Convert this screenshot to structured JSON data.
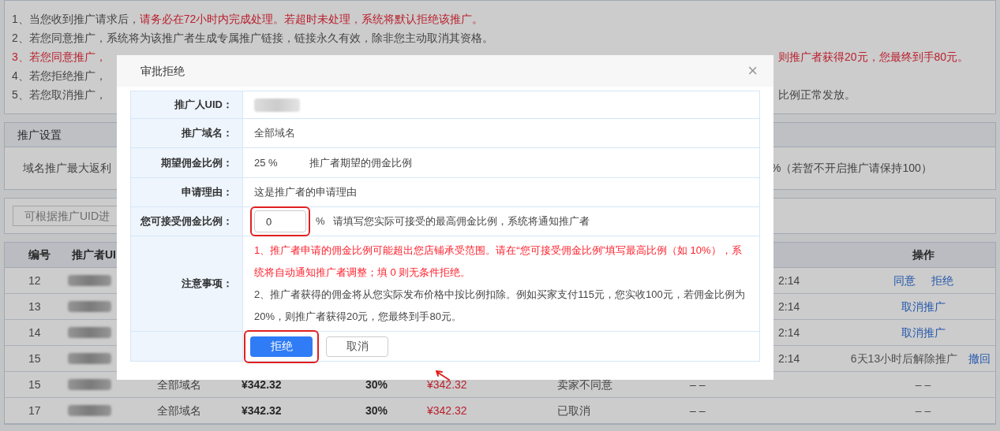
{
  "notices": [
    {
      "left": [
        {
          "text": "1、当您收到推广请求后，",
          "alert": false
        },
        {
          "text": "请务必在72小时内完成处理。若超时未处理，系统将默认拒绝该推广。",
          "alert": true
        }
      ]
    },
    {
      "left": [
        {
          "text": "2、若您同意推广，系统将为该推广者生成专属推广链接，链接永久有效，除非您主动取消其资格。",
          "alert": false
        }
      ]
    },
    {
      "left": [
        {
          "text": "3、若您同意推广，",
          "alert": true
        }
      ],
      "right": {
        "text": "则推广者获得20元，您最终到手80元。",
        "alert": true
      }
    },
    {
      "left": [
        {
          "text": "4、若您拒绝推广，",
          "alert": false
        }
      ]
    },
    {
      "left": [
        {
          "text": "5、若您取消推广，",
          "alert": false
        }
      ],
      "right": {
        "text": "比例正常发放。",
        "alert": false
      }
    }
  ],
  "settings": {
    "title": "推广设置",
    "label": "域名推广最大返利",
    "hint": "%（若暂不开启推广请保持100）"
  },
  "search": {
    "placeholder": "可根据推广UID进"
  },
  "table": {
    "columns": [
      "编号",
      "推广者UI"
    ],
    "action_column": "操作",
    "rows": [
      {
        "id": "12",
        "time": "2:14",
        "actions": [
          {
            "text": "同意",
            "kind": "link"
          },
          {
            "text": "拒绝",
            "kind": "link"
          }
        ]
      },
      {
        "id": "13",
        "time": "2:14",
        "actions": [
          {
            "text": "取消推广",
            "kind": "link"
          }
        ]
      },
      {
        "id": "14",
        "time": "2:14",
        "actions": [
          {
            "text": "取消推广",
            "kind": "link"
          }
        ]
      },
      {
        "id": "15",
        "time": "2:14",
        "actions": [
          {
            "text": "6天13小时后解除推广",
            "kind": "text"
          },
          {
            "text": "撤回",
            "kind": "link"
          }
        ]
      },
      {
        "id": "15",
        "domain": "全部域名",
        "price": "¥342.32",
        "ratio": "30%",
        "income": "¥342.32",
        "status": "卖家不同意",
        "time": "– –",
        "actions": [
          {
            "text": "– –",
            "kind": "text"
          }
        ]
      },
      {
        "id": "17",
        "domain": "全部域名",
        "price": "¥342.32",
        "ratio": "30%",
        "income": "¥342.32",
        "status": "已取消",
        "time": "– –",
        "actions": [
          {
            "text": "– –",
            "kind": "text"
          }
        ]
      }
    ]
  },
  "dialog": {
    "title": "审批拒绝",
    "close": "×",
    "fields": [
      {
        "kind": "blurred",
        "label": "推广人UID："
      },
      {
        "kind": "text",
        "label": "推广域名：",
        "value": "全部域名"
      },
      {
        "kind": "ratio",
        "label": "期望佣金比例：",
        "value": "25 %",
        "hint": "推广者期望的佣金比例"
      },
      {
        "kind": "text",
        "label": "申请理由：",
        "value": "这是推广者的申请理由"
      },
      {
        "kind": "input",
        "label": "您可接受佣金比例：",
        "value": "0",
        "unit": "%",
        "hint": "请填写您实际可接受的最高佣金比例，系统将通知推广者",
        "highlighted": true
      },
      {
        "kind": "notes",
        "label": "注意事项：",
        "notes": [
          {
            "text": "1、推广者申请的佣金比例可能超出您店铺承受范围。请在“您可接受佣金比例”填写最高比例（如 10%），系统将自动通知推广者调整；填 0 则无条件拒绝。",
            "alert": true
          },
          {
            "text": "2、推广者获得的佣金将从您实际发布价格中按比例扣除。例如买家支付115元，您实收100元，若佣金比例为20%，则推广者获得20元，您最终到手80元。",
            "alert": false
          }
        ]
      },
      {
        "kind": "buttons",
        "buttons": [
          {
            "text": "拒绝",
            "primary": true,
            "highlighted": true
          },
          {
            "text": "取消",
            "primary": false,
            "highlighted": false
          }
        ]
      }
    ]
  }
}
